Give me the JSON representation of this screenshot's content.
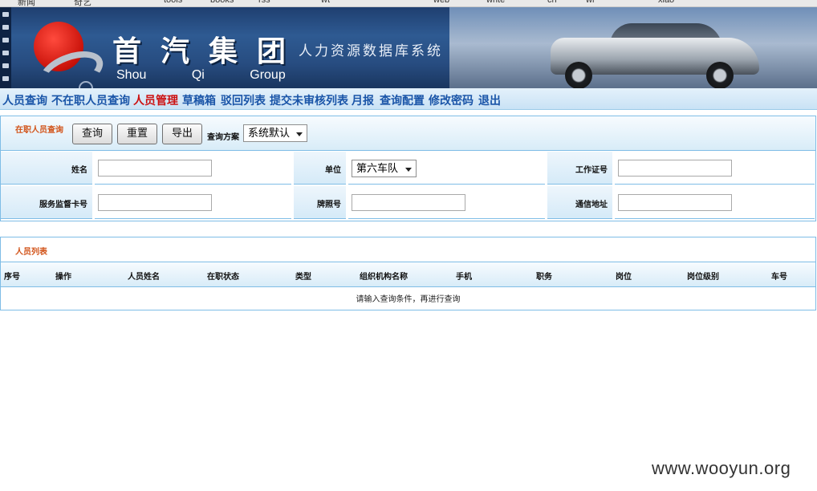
{
  "bookmarks": [
    "新闻",
    "奇艺",
    "tools",
    "books",
    "rss",
    "wt",
    "web",
    "write",
    "ch",
    "wi",
    "xiao"
  ],
  "header": {
    "company_cn": "首汽集团",
    "company_en": "Shou Qi Group",
    "system_name": "人力资源数据库系统"
  },
  "nav": {
    "items": [
      "人员查询",
      "不在职人员查询",
      "人员管理",
      "草稿箱",
      "驳回列表",
      "提交未审核列表",
      "月报",
      "查询配置",
      "修改密码",
      "退出"
    ],
    "active": "人员管理"
  },
  "search_panel": {
    "title": "在职人员查询",
    "buttons": {
      "query": "查询",
      "reset": "重置",
      "export": "导出"
    },
    "scheme_label": "查询方案",
    "scheme_value": "系统默认",
    "fields": {
      "name_label": "姓名",
      "unit_label": "单位",
      "unit_value": "第六车队",
      "work_cert_label": "工作证号",
      "service_card_label": "服务监督卡号",
      "plate_label": "牌照号",
      "address_label": "通信地址"
    }
  },
  "list_panel": {
    "title": "人员列表",
    "columns": [
      "序号",
      "操作",
      "人员姓名",
      "在职状态",
      "类型",
      "组织机构名称",
      "手机",
      "职务",
      "岗位",
      "岗位级别",
      "车号"
    ],
    "empty_message": "请输入查询条件，再进行查询"
  },
  "watermark": "www.wooyun.org"
}
